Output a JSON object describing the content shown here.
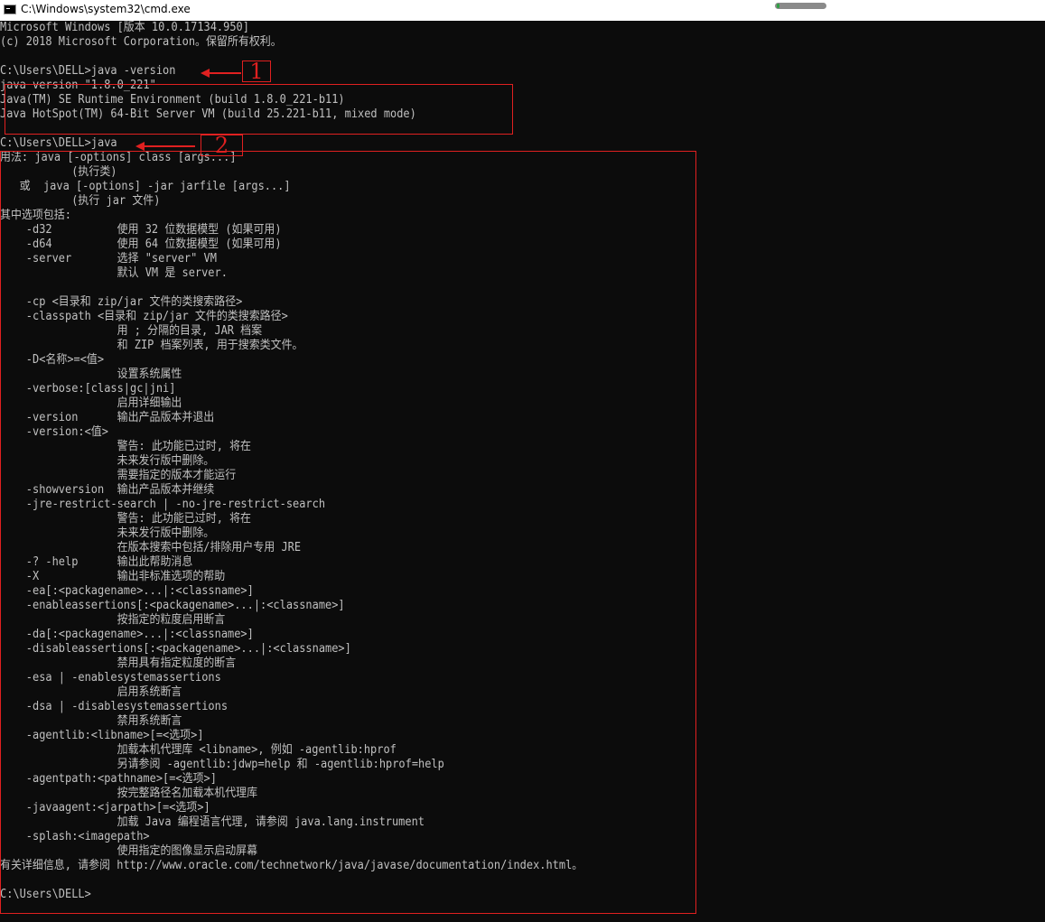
{
  "window": {
    "title": "C:\\Windows\\system32\\cmd.exe",
    "icon": "console-icon",
    "colors": {
      "console_bg": "#0c0c0c",
      "console_text": "#c0c0c0",
      "annotation": "#e02020"
    }
  },
  "console": {
    "lines": [
      "Microsoft Windows [版本 10.0.17134.950]",
      "(c) 2018 Microsoft Corporation。保留所有权利。",
      "",
      "C:\\Users\\DELL>java -version",
      "java version \"1.8.0_221\"",
      "Java(TM) SE Runtime Environment (build 1.8.0_221-b11)",
      "Java HotSpot(TM) 64-Bit Server VM (build 25.221-b11, mixed mode)",
      "",
      "C:\\Users\\DELL>java",
      "用法: java [-options] class [args...]",
      "           (执行类)",
      "   或  java [-options] -jar jarfile [args...]",
      "           (执行 jar 文件)",
      "其中选项包括:",
      "    -d32          使用 32 位数据模型 (如果可用)",
      "    -d64          使用 64 位数据模型 (如果可用)",
      "    -server       选择 \"server\" VM",
      "                  默认 VM 是 server.",
      "",
      "    -cp <目录和 zip/jar 文件的类搜索路径>",
      "    -classpath <目录和 zip/jar 文件的类搜索路径>",
      "                  用 ; 分隔的目录, JAR 档案",
      "                  和 ZIP 档案列表, 用于搜索类文件。",
      "    -D<名称>=<值>",
      "                  设置系统属性",
      "    -verbose:[class|gc|jni]",
      "                  启用详细输出",
      "    -version      输出产品版本并退出",
      "    -version:<值>",
      "                  警告: 此功能已过时, 将在",
      "                  未来发行版中删除。",
      "                  需要指定的版本才能运行",
      "    -showversion  输出产品版本并继续",
      "    -jre-restrict-search | -no-jre-restrict-search",
      "                  警告: 此功能已过时, 将在",
      "                  未来发行版中删除。",
      "                  在版本搜索中包括/排除用户专用 JRE",
      "    -? -help      输出此帮助消息",
      "    -X            输出非标准选项的帮助",
      "    -ea[:<packagename>...|:<classname>]",
      "    -enableassertions[:<packagename>...|:<classname>]",
      "                  按指定的粒度启用断言",
      "    -da[:<packagename>...|:<classname>]",
      "    -disableassertions[:<packagename>...|:<classname>]",
      "                  禁用具有指定粒度的断言",
      "    -esa | -enablesystemassertions",
      "                  启用系统断言",
      "    -dsa | -disablesystemassertions",
      "                  禁用系统断言",
      "    -agentlib:<libname>[=<选项>]",
      "                  加载本机代理库 <libname>, 例如 -agentlib:hprof",
      "                  另请参阅 -agentlib:jdwp=help 和 -agentlib:hprof=help",
      "    -agentpath:<pathname>[=<选项>]",
      "                  按完整路径名加载本机代理库",
      "    -javaagent:<jarpath>[=<选项>]",
      "                  加载 Java 编程语言代理, 请参阅 java.lang.instrument",
      "    -splash:<imagepath>",
      "                  使用指定的图像显示启动屏幕",
      "有关详细信息, 请参阅 http://www.oracle.com/technetwork/java/javase/documentation/index.html。",
      "",
      "C:\\Users\\DELL>"
    ]
  },
  "annotations": {
    "marker_1": "1",
    "marker_2": "2"
  }
}
